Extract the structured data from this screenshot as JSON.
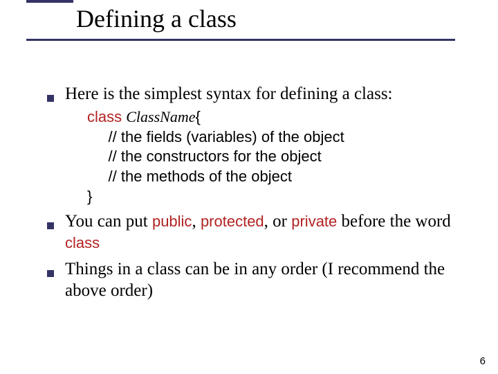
{
  "title": "Defining a class",
  "bullets": {
    "b1": "Here is the simplest syntax for defining a class:",
    "b2_pre": "You can put ",
    "b2_kw1": "public",
    "b2_sep1": ", ",
    "b2_kw2": "protected",
    "b2_sep2": ", or ",
    "b2_kw3": "private",
    "b2_after": " before the word ",
    "b2_kw4": "class",
    "b3": "Things in a class can be in any order (I recommend the above order)"
  },
  "code": {
    "kw_class": "class ",
    "classname": "ClassName",
    "brace_open": "{",
    "line1": "     // the fields (variables) of the object",
    "line2": "     // the constructors for the object",
    "line3": "     // the methods of the object",
    "brace_close": "}"
  },
  "page": "6"
}
